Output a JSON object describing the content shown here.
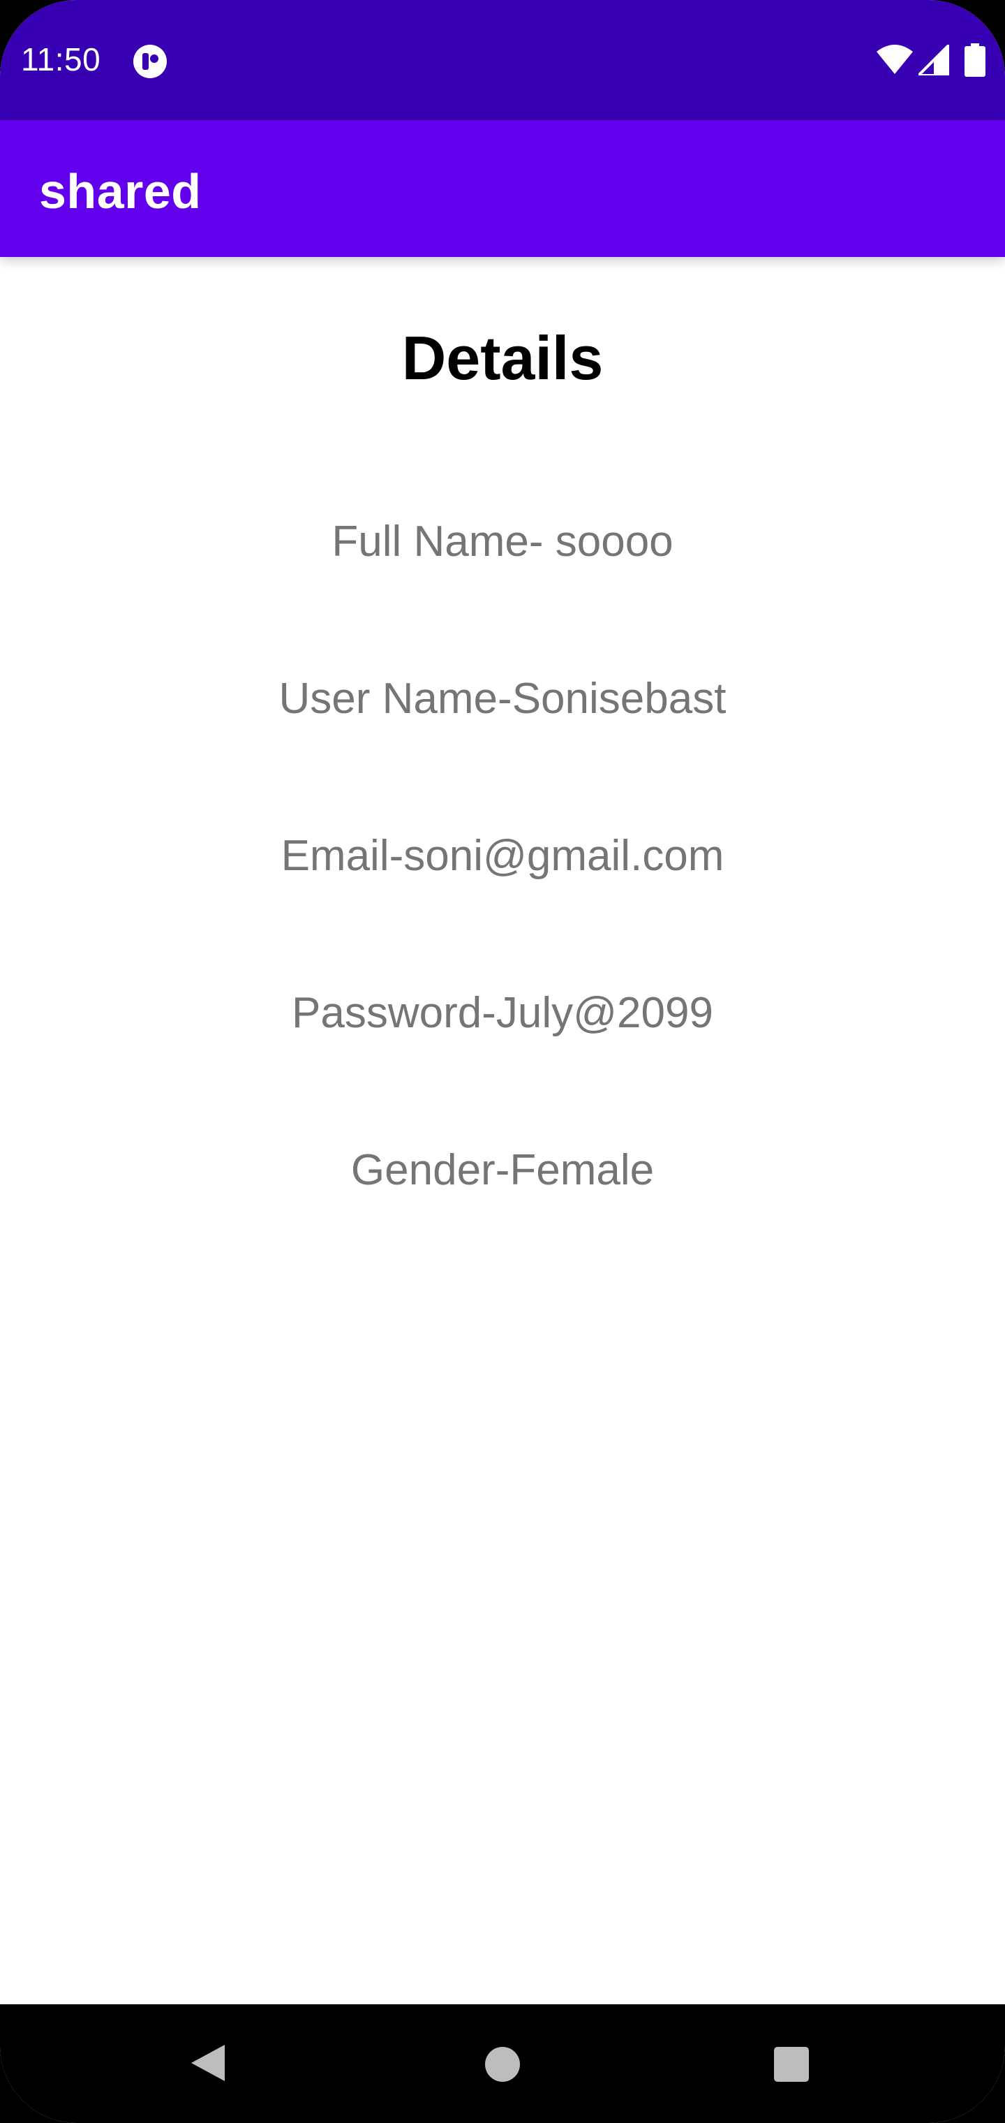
{
  "status_bar": {
    "time": "11:50",
    "icons": [
      "notification-icon",
      "wifi-icon",
      "cell-signal-icon",
      "battery-icon"
    ],
    "background_color": "#3700b3"
  },
  "app_bar": {
    "title": "shared",
    "background_color": "#6200ee"
  },
  "content": {
    "heading": "Details",
    "details": [
      "Full Name- soooo",
      "User Name-Sonisebast",
      "Email-soni@gmail.com",
      "Password-July@2099",
      "Gender-Female"
    ],
    "text_color": "#757575"
  },
  "nav_bar": {
    "buttons": [
      "back-icon",
      "home-icon",
      "recents-icon"
    ]
  }
}
